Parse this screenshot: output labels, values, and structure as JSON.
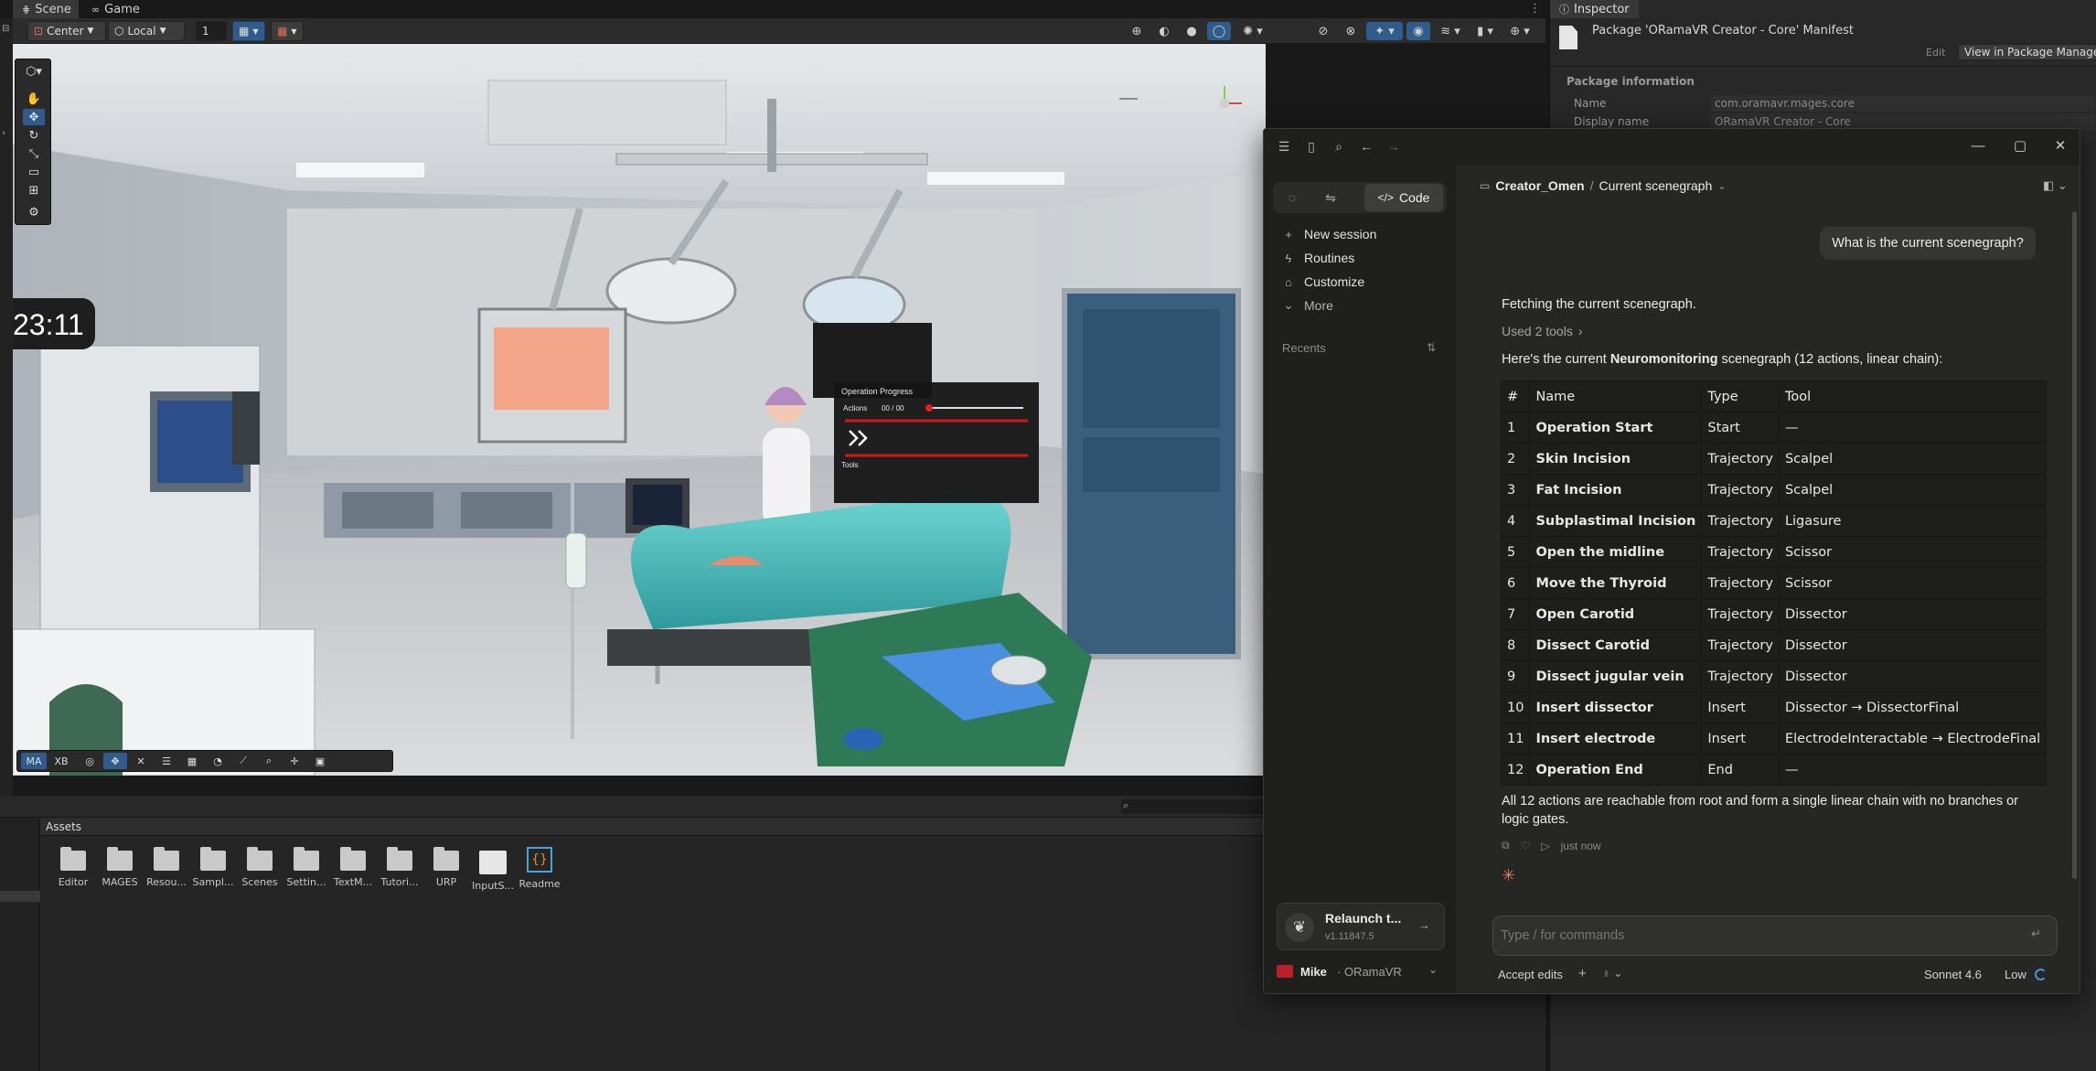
{
  "unity": {
    "tabs": {
      "scene": "Scene",
      "game": "Game"
    },
    "toolbar": {
      "pivot": "Center",
      "space": "Local",
      "snap_value": "1"
    },
    "overlay_bar": {
      "ma": "MA",
      "xb": "XB"
    },
    "scene_overlay": {
      "clock": "23:11",
      "progress_title": "Operation Progress",
      "actions_label": "Actions",
      "actions_value": "00 / 00",
      "tools_label": "Tools"
    },
    "assets": {
      "header": "Assets",
      "items": [
        {
          "label": "Editor",
          "type": "folder"
        },
        {
          "label": "MAGES",
          "type": "folder"
        },
        {
          "label": "Resou...",
          "type": "folder"
        },
        {
          "label": "Sampl...",
          "type": "folder"
        },
        {
          "label": "Scenes",
          "type": "folder"
        },
        {
          "label": "Settin...",
          "type": "folder"
        },
        {
          "label": "TextM...",
          "type": "folder"
        },
        {
          "label": "Tutori...",
          "type": "folder"
        },
        {
          "label": "URP",
          "type": "folder"
        },
        {
          "label": "InputS...",
          "type": "input-asset"
        },
        {
          "label": "Readme",
          "type": "readme-asset"
        }
      ]
    },
    "inspector": {
      "tab": "Inspector",
      "title": "Package 'ORamaVR Creator - Core' Manifest",
      "edit_button": "Edit",
      "view_button": "View in Package Manage",
      "section": "Package information",
      "fields": [
        {
          "label": "Name",
          "value": "com.oramavr.mages.core"
        },
        {
          "label": "Display name",
          "value": "ORamaVR Creator - Core"
        }
      ]
    }
  },
  "claude": {
    "mode_tabs": {
      "code": "Code"
    },
    "sidebar": {
      "items": [
        "New session",
        "Routines",
        "Customize",
        "More"
      ],
      "recents_label": "Recents",
      "update_title": "Relaunch t...",
      "update_version": "v1.11847.5",
      "user_name": "Mike",
      "user_org": "· ORamaVR"
    },
    "header": {
      "project": "Creator_Omen",
      "separator": "/",
      "context": "Current scenegraph"
    },
    "user_message": "What is the current scenegraph?",
    "assistant": {
      "line1": "Fetching the current scenegraph.",
      "tools_used": "Used 2 tools",
      "intro_prefix": "Here's the current ",
      "intro_bold": "Neuromonitoring",
      "intro_suffix": " scenegraph (12 actions, linear chain):",
      "table": {
        "headers": [
          "#",
          "Name",
          "Type",
          "Tool"
        ],
        "rows": [
          [
            "1",
            "Operation Start",
            "Start",
            "—"
          ],
          [
            "2",
            "Skin Incision",
            "Trajectory",
            "Scalpel"
          ],
          [
            "3",
            "Fat Incision",
            "Trajectory",
            "Scalpel"
          ],
          [
            "4",
            "Subplastimal Incision",
            "Trajectory",
            "Ligasure"
          ],
          [
            "5",
            "Open the midline",
            "Trajectory",
            "Scissor"
          ],
          [
            "6",
            "Move the Thyroid",
            "Trajectory",
            "Scissor"
          ],
          [
            "7",
            "Open Carotid",
            "Trajectory",
            "Dissector"
          ],
          [
            "8",
            "Dissect Carotid",
            "Trajectory",
            "Dissector"
          ],
          [
            "9",
            "Dissect jugular vein",
            "Trajectory",
            "Dissector"
          ],
          [
            "10",
            "Insert dissector",
            "Insert",
            "Dissector → DissectorFinal"
          ],
          [
            "11",
            "Insert electrode",
            "Insert",
            "ElectrodeInteractable → ElectrodeFinal"
          ],
          [
            "12",
            "Operation End",
            "End",
            "—"
          ]
        ]
      },
      "summary_line1": "All 12 actions are reachable from root and form a single linear chain with no branches or",
      "summary_line2": "logic gates.",
      "timestamp": "just now"
    },
    "composer": {
      "placeholder": "Type / for commands",
      "accept_edits": "Accept edits",
      "model": "Sonnet 4.6",
      "effort": "Low"
    },
    "colors": {
      "accent": "#d97757",
      "background": "#262624"
    }
  }
}
